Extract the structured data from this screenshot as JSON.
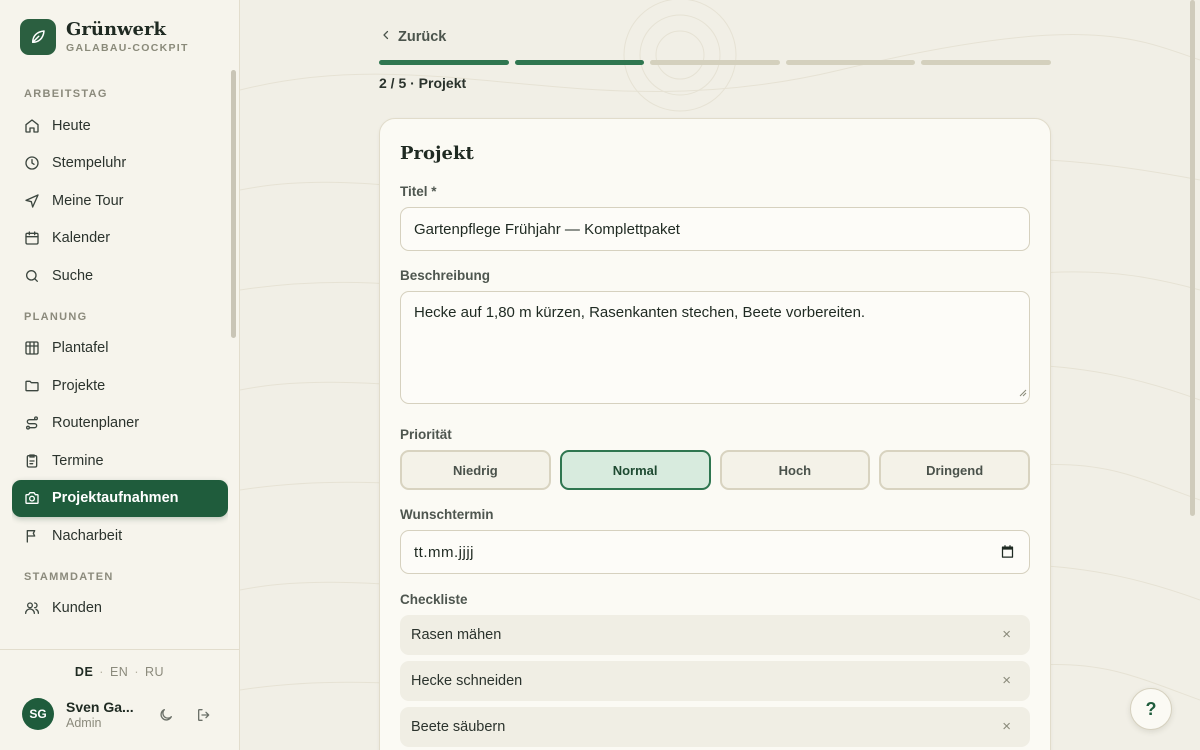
{
  "brand": {
    "name": "Grünwerk",
    "subtitle": "GALABAU-COCKPIT"
  },
  "sidebar": {
    "sections": [
      {
        "label": "ARBEITSTAG",
        "items": [
          {
            "label": "Heute",
            "icon": "home-icon"
          },
          {
            "label": "Stempeluhr",
            "icon": "clock-icon"
          },
          {
            "label": "Meine Tour",
            "icon": "navigation-icon"
          },
          {
            "label": "Kalender",
            "icon": "calendar-icon"
          },
          {
            "label": "Suche",
            "icon": "search-icon"
          }
        ]
      },
      {
        "label": "PLANUNG",
        "items": [
          {
            "label": "Plantafel",
            "icon": "board-icon"
          },
          {
            "label": "Projekte",
            "icon": "folder-icon"
          },
          {
            "label": "Routenplaner",
            "icon": "route-icon"
          },
          {
            "label": "Termine",
            "icon": "clipboard-icon"
          },
          {
            "label": "Projektaufnahmen",
            "icon": "camera-icon",
            "active": true
          },
          {
            "label": "Nacharbeit",
            "icon": "flag-icon"
          }
        ]
      },
      {
        "label": "STAMMDATEN",
        "items": [
          {
            "label": "Kunden",
            "icon": "users-icon"
          }
        ]
      }
    ],
    "languages": [
      "DE",
      "EN",
      "RU"
    ],
    "active_language": "DE",
    "user": {
      "initials": "SG",
      "name": "Sven Ga...",
      "role": "Admin"
    }
  },
  "wizard": {
    "back_label": "Zurück",
    "steps_total": 5,
    "steps_done": 2,
    "step_label": "2 / 5 · Projekt"
  },
  "form": {
    "title": "Projekt",
    "titel_label": "Titel *",
    "titel_value": "Gartenpflege Frühjahr — Komplettpaket",
    "beschreibung_label": "Beschreibung",
    "beschreibung_value": "Hecke auf 1,80 m kürzen, Rasenkanten stechen, Beete vorbereiten.",
    "prioritaet_label": "Priorität",
    "prioritaet_options": [
      "Niedrig",
      "Normal",
      "Hoch",
      "Dringend"
    ],
    "prioritaet_selected": "Normal",
    "wunschtermin_label": "Wunschtermin",
    "wunschtermin_placeholder": "tt.mm.jjjj",
    "checkliste_label": "Checkliste",
    "checkliste_items": [
      "Rasen mähen",
      "Hecke schneiden",
      "Beete säubern"
    ]
  },
  "help_label": "?",
  "colors": {
    "accent": "#1f5c3c",
    "progress": "#2f7650",
    "background": "#f1efe6"
  }
}
